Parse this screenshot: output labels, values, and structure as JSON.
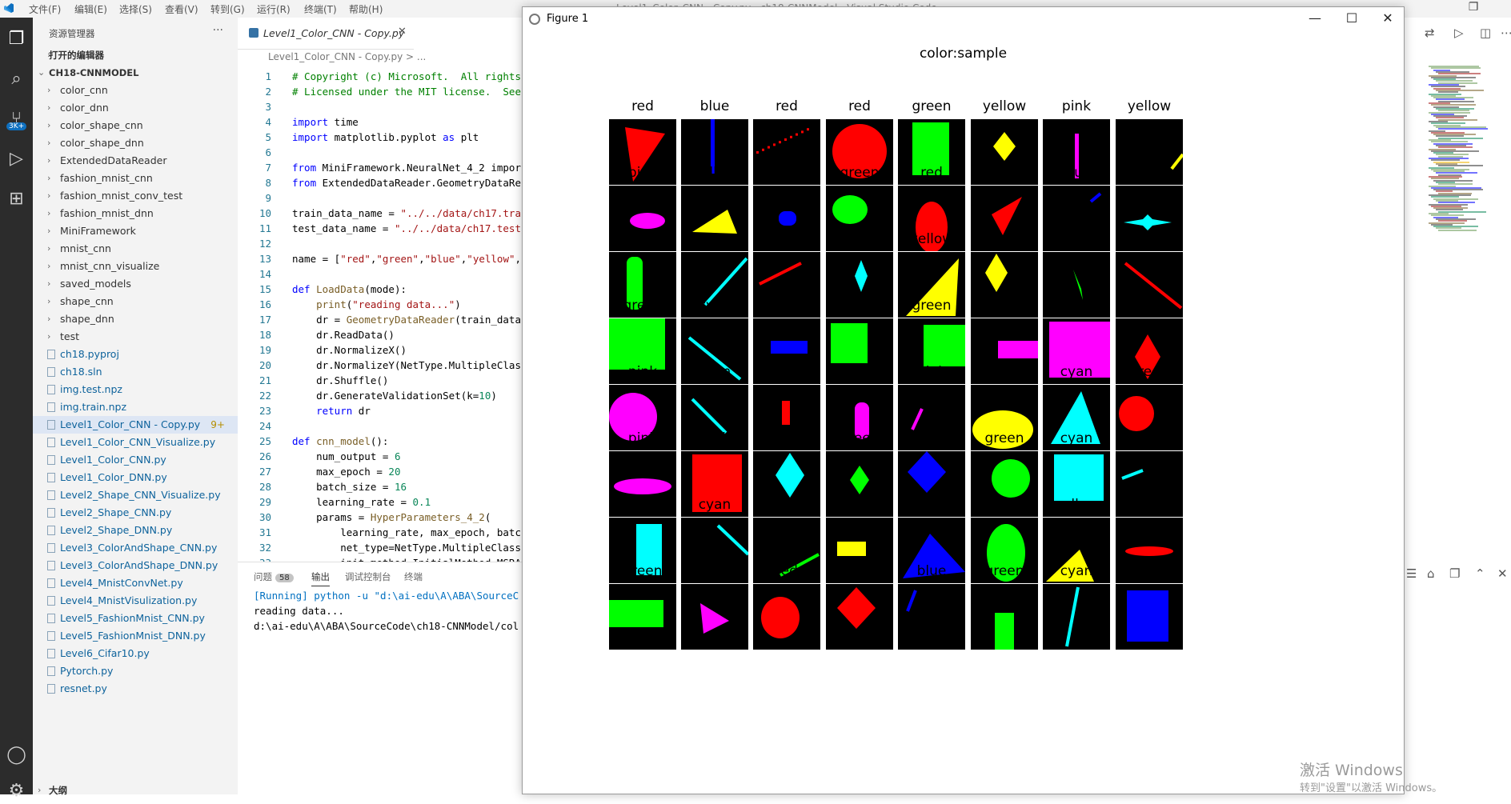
{
  "titlebar": {
    "menus": [
      "文件(F)",
      "编辑(E)",
      "选择(S)",
      "查看(V)",
      "转到(G)",
      "运行(R)",
      "终端(T)",
      "帮助(H)"
    ],
    "window_title": "Level1_Color_CNN - Copy.py - ch18-CNNModel - Visual Studio Code"
  },
  "activity": {
    "badge": "3K+"
  },
  "sidebar": {
    "header": "资源管理器",
    "open_editors": "打开的编辑器",
    "project": "CH18-CNNMODEL",
    "folders": [
      "color_cnn",
      "color_dnn",
      "color_shape_cnn",
      "color_shape_dnn",
      "ExtendedDataReader",
      "fashion_mnist_cnn",
      "fashion_mnist_conv_test",
      "fashion_mnist_dnn",
      "MiniFramework",
      "mnist_cnn",
      "mnist_cnn_visualize",
      "saved_models",
      "shape_cnn",
      "shape_dnn",
      "test"
    ],
    "files": [
      "ch18.pyproj",
      "ch18.sln",
      "img.test.npz",
      "img.train.npz",
      "Level1_Color_CNN - Copy.py",
      "Level1_Color_CNN_Visualize.py",
      "Level1_Color_CNN.py",
      "Level1_Color_DNN.py",
      "Level2_Shape_CNN_Visualize.py",
      "Level2_Shape_CNN.py",
      "Level2_Shape_DNN.py",
      "Level3_ColorAndShape_CNN.py",
      "Level3_ColorAndShape_DNN.py",
      "Level4_MnistConvNet.py",
      "Level4_MnistVisulization.py",
      "Level5_FashionMnist_CNN.py",
      "Level5_FashionMnist_DNN.py",
      "Level6_Cifar10.py",
      "Pytorch.py",
      "resnet.py"
    ],
    "active_file_badge": "9+",
    "outline": "大纲"
  },
  "editor": {
    "tab_label": "Level1_Color_CNN - Copy.py",
    "breadcrumb": "Level1_Color_CNN - Copy.py > ...",
    "lines": [
      {
        "n": "1",
        "t": "# Copyright (c) Microsoft.  All rights"
      },
      {
        "n": "2",
        "t": "# Licensed under the MIT license.  See"
      },
      {
        "n": "3",
        "t": ""
      },
      {
        "n": "4",
        "t": "import time"
      },
      {
        "n": "5",
        "t": "import matplotlib.pyplot as plt"
      },
      {
        "n": "6",
        "t": ""
      },
      {
        "n": "7",
        "t": "from MiniFramework.NeuralNet_4_2 impor"
      },
      {
        "n": "8",
        "t": "from ExtendedDataReader.GeometryDataRe"
      },
      {
        "n": "9",
        "t": ""
      },
      {
        "n": "10",
        "t": "train_data_name = \"../../data/ch17.tra"
      },
      {
        "n": "11",
        "t": "test_data_name = \"../../data/ch17.test"
      },
      {
        "n": "12",
        "t": ""
      },
      {
        "n": "13",
        "t": "name = [\"red\",\"green\",\"blue\",\"yellow\","
      },
      {
        "n": "14",
        "t": ""
      },
      {
        "n": "15",
        "t": "def LoadData(mode):"
      },
      {
        "n": "16",
        "t": "    print(\"reading data...\")"
      },
      {
        "n": "17",
        "t": "    dr = GeometryDataReader(train_data"
      },
      {
        "n": "18",
        "t": "    dr.ReadData()"
      },
      {
        "n": "19",
        "t": "    dr.NormalizeX()"
      },
      {
        "n": "20",
        "t": "    dr.NormalizeY(NetType.MultipleClas"
      },
      {
        "n": "21",
        "t": "    dr.Shuffle()"
      },
      {
        "n": "22",
        "t": "    dr.GenerateValidationSet(k=10)"
      },
      {
        "n": "23",
        "t": "    return dr"
      },
      {
        "n": "24",
        "t": ""
      },
      {
        "n": "25",
        "t": "def cnn_model():"
      },
      {
        "n": "26",
        "t": "    num_output = 6"
      },
      {
        "n": "27",
        "t": "    max_epoch = 20"
      },
      {
        "n": "28",
        "t": "    batch_size = 16"
      },
      {
        "n": "29",
        "t": "    learning_rate = 0.1"
      },
      {
        "n": "30",
        "t": "    params = HyperParameters_4_2("
      },
      {
        "n": "31",
        "t": "        learning_rate, max_epoch, batc"
      },
      {
        "n": "32",
        "t": "        net_type=NetType.MultipleClass"
      },
      {
        "n": "33",
        "t": "        init_method=InitialMethod.MSRA"
      }
    ]
  },
  "panel": {
    "tabs": [
      "问题",
      "输出",
      "调试控制台",
      "终端"
    ],
    "problems_count": "58",
    "output": [
      "[Running] python -u \"d:\\ai-edu\\A\\ABA\\SourceC",
      "reading data...",
      "d:\\ai-edu\\A\\ABA\\SourceCode\\ch18-CNNModel/col"
    ]
  },
  "figure": {
    "window_title": "Figure 1",
    "suptitle": "color:sample",
    "labels": [
      [
        "red",
        "blue",
        "red",
        "red",
        "green",
        "yellow",
        "pink",
        "yellow"
      ],
      [
        "pink",
        "yellow",
        "blue",
        "green",
        "red",
        "red",
        "blue",
        "cyan"
      ],
      [
        "green",
        "cyan",
        "red",
        "cyan",
        "yellow",
        "yellow",
        "green",
        "red"
      ],
      [
        "green",
        "cyan",
        "blue",
        "green",
        "green",
        "pink",
        "pink",
        "red"
      ],
      [
        "pink",
        "cyan",
        "red",
        "pink",
        "pink",
        "yellow",
        "cyan",
        "red"
      ],
      [
        "pink",
        "red",
        "cyan",
        "green",
        "blue",
        "green",
        "cyan",
        "cyan"
      ],
      [
        "cyan",
        "cyan",
        "green",
        "yellow",
        "blue",
        "green",
        "yellow",
        "red"
      ],
      [
        "green",
        "pink",
        "red",
        "red",
        "blue",
        "green",
        "cyan",
        "blue"
      ]
    ],
    "colors": {
      "red": "#ff0000",
      "green": "#00ff00",
      "blue": "#0000ff",
      "yellow": "#ffff00",
      "cyan": "#00ffff",
      "pink": "#ff00ff"
    }
  },
  "watermark": {
    "line1": "激活 Windows",
    "line2": "转到\"设置\"以激活 Windows。"
  }
}
